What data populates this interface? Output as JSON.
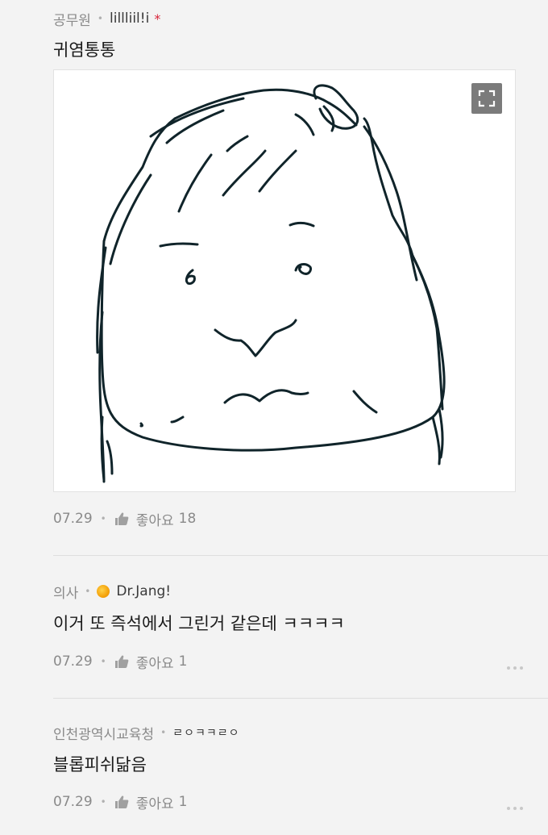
{
  "comments": [
    {
      "job": "공무원",
      "nickname": "lillliil!i",
      "verified_mark": "*",
      "text": "귀염통통",
      "date": "07.29",
      "like_label": "좋아요",
      "like_count": "18"
    },
    {
      "job": "의사",
      "nickname": "Dr.Jang!",
      "text": "이거 또 즉석에서 그린거 같은데 ㅋㅋㅋㅋ",
      "date": "07.29",
      "like_label": "좋아요",
      "like_count": "1"
    },
    {
      "job": "인천광역시교육청",
      "nickname": "ㄹㅇㅋㅋㄹㅇ",
      "text": "블롭피쉬닮음",
      "date": "07.29",
      "like_label": "좋아요",
      "like_count": "1"
    }
  ],
  "colors": {
    "background": "#f3f3f3",
    "meta_text": "#8a8a8a",
    "star": "#d8243a",
    "divider": "#dedede"
  },
  "icons": [
    "thumbs-up-icon",
    "more-dots-icon",
    "expand-icon",
    "badge-icon"
  ]
}
